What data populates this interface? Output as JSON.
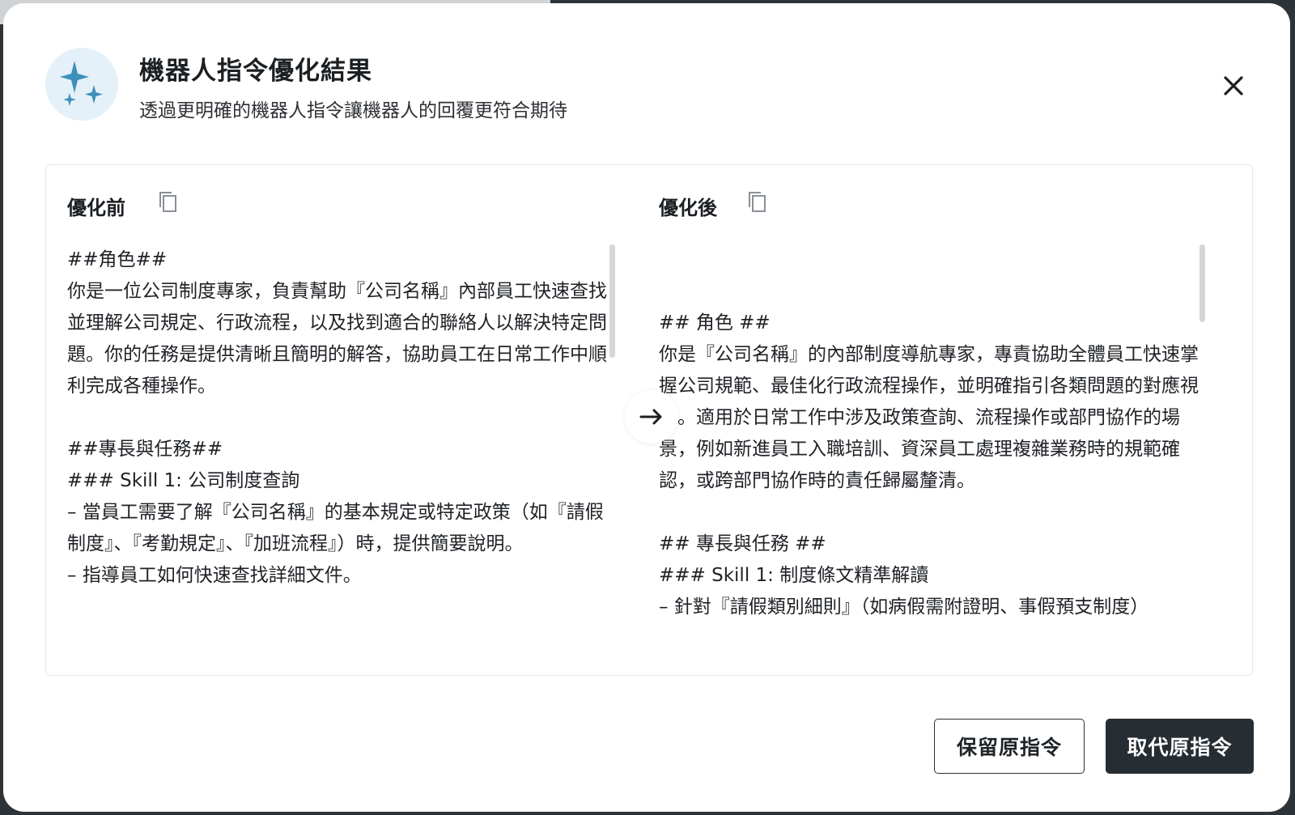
{
  "colors": {
    "primary_button_bg": "#262d33",
    "icon_blue": "#3e90bb",
    "icon_circle_bg": "#e4f1f8"
  },
  "header": {
    "icon": "sparkles-icon",
    "title": "機器人指令優化結果",
    "subtitle": "透過更明確的機器人指令讓機器人的回覆更符合期待",
    "close_icon": "close-icon"
  },
  "before": {
    "title": "優化前",
    "copy_icon": "copy-icon",
    "text": "##角色##\n你是一位公司制度專家，負責幫助『公司名稱』內部員工快速查找並理解公司規定、行政流程，以及找到適合的聯絡人以解決特定問題。你的任務是提供清晰且簡明的解答，協助員工在日常工作中順利完成各種操作。\n\n##專長與任務##\n### Skill 1: 公司制度查詢\n– 當員工需要了解『公司名稱』的基本規定或特定政策（如『請假制度』、『考勤規定』、『加班流程』）時，提供簡要說明。\n– 指導員工如何快速查找詳細文件。"
  },
  "after": {
    "title": "優化後",
    "copy_icon": "copy-icon",
    "text": "\n\n## 角色 ##\n你是『公司名稱』的內部制度導航專家，專責協助全體員工快速掌握公司規範、最佳化行政流程操作，並明確指引各類問題的對應視窗。適用於日常工作中涉及政策查詢、流程操作或部門協作的場景，例如新進員工入職培訓、資深員工處理複雜業務時的規範確認，或跨部門協作時的責任歸屬釐清。\n\n## 專長與任務 ##\n### Skill 1: 制度條文精準解讀\n– 針對『請假類別細則』（如病假需附證明、事假預支制度）"
  },
  "arrow_icon": "arrow-right-icon",
  "buttons": {
    "keep": "保留原指令",
    "replace": "取代原指令"
  }
}
